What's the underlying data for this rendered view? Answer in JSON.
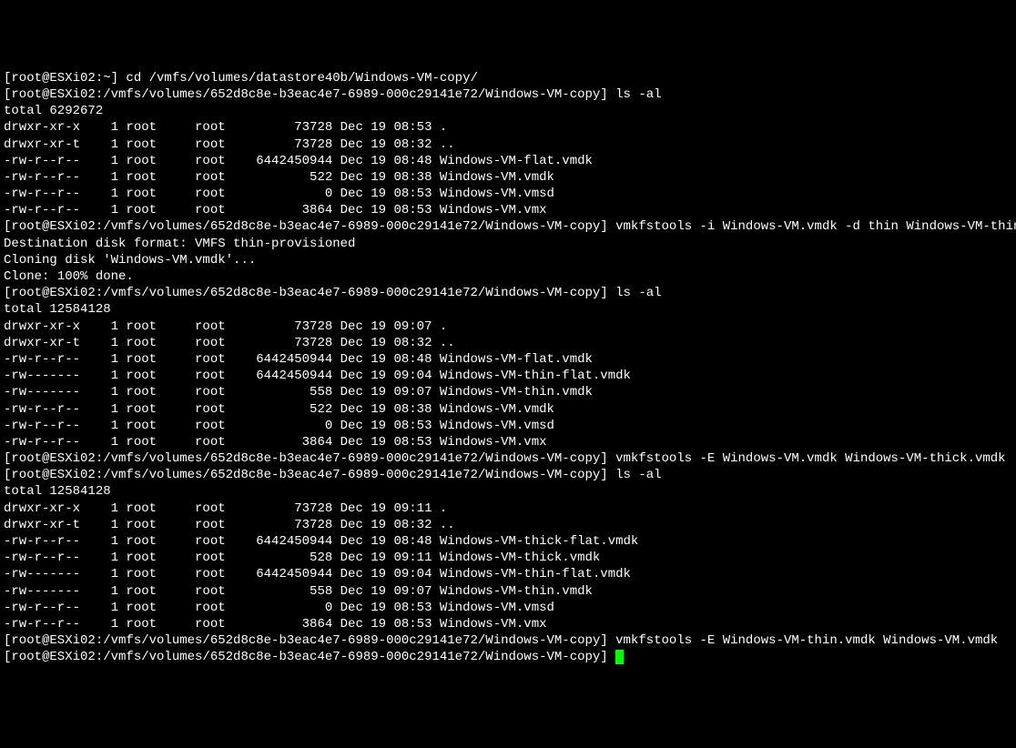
{
  "lines": [
    "[root@ESXi02:~] cd /vmfs/volumes/datastore40b/Windows-VM-copy/",
    "[root@ESXi02:/vmfs/volumes/652d8c8e-b3eac4e7-6989-000c29141e72/Windows-VM-copy] ls -al",
    "total 6292672",
    "drwxr-xr-x    1 root     root         73728 Dec 19 08:53 .",
    "drwxr-xr-t    1 root     root         73728 Dec 19 08:32 ..",
    "-rw-r--r--    1 root     root    6442450944 Dec 19 08:48 Windows-VM-flat.vmdk",
    "-rw-r--r--    1 root     root           522 Dec 19 08:38 Windows-VM.vmdk",
    "-rw-r--r--    1 root     root             0 Dec 19 08:53 Windows-VM.vmsd",
    "-rw-r--r--    1 root     root          3864 Dec 19 08:53 Windows-VM.vmx",
    "[root@ESXi02:/vmfs/volumes/652d8c8e-b3eac4e7-6989-000c29141e72/Windows-VM-copy] vmkfstools -i Windows-VM.vmdk -d thin Windows-VM-thin.vmdk",
    "Destination disk format: VMFS thin-provisioned",
    "Cloning disk 'Windows-VM.vmdk'...",
    "Clone: 100% done.",
    "[root@ESXi02:/vmfs/volumes/652d8c8e-b3eac4e7-6989-000c29141e72/Windows-VM-copy] ls -al",
    "total 12584128",
    "drwxr-xr-x    1 root     root         73728 Dec 19 09:07 .",
    "drwxr-xr-t    1 root     root         73728 Dec 19 08:32 ..",
    "-rw-r--r--    1 root     root    6442450944 Dec 19 08:48 Windows-VM-flat.vmdk",
    "-rw-------    1 root     root    6442450944 Dec 19 09:04 Windows-VM-thin-flat.vmdk",
    "-rw-------    1 root     root           558 Dec 19 09:07 Windows-VM-thin.vmdk",
    "-rw-r--r--    1 root     root           522 Dec 19 08:38 Windows-VM.vmdk",
    "-rw-r--r--    1 root     root             0 Dec 19 08:53 Windows-VM.vmsd",
    "-rw-r--r--    1 root     root          3864 Dec 19 08:53 Windows-VM.vmx",
    "[root@ESXi02:/vmfs/volumes/652d8c8e-b3eac4e7-6989-000c29141e72/Windows-VM-copy] vmkfstools -E Windows-VM.vmdk Windows-VM-thick.vmdk",
    "[root@ESXi02:/vmfs/volumes/652d8c8e-b3eac4e7-6989-000c29141e72/Windows-VM-copy] ls -al",
    "total 12584128",
    "drwxr-xr-x    1 root     root         73728 Dec 19 09:11 .",
    "drwxr-xr-t    1 root     root         73728 Dec 19 08:32 ..",
    "-rw-r--r--    1 root     root    6442450944 Dec 19 08:48 Windows-VM-thick-flat.vmdk",
    "-rw-r--r--    1 root     root           528 Dec 19 09:11 Windows-VM-thick.vmdk",
    "-rw-------    1 root     root    6442450944 Dec 19 09:04 Windows-VM-thin-flat.vmdk",
    "-rw-------    1 root     root           558 Dec 19 09:07 Windows-VM-thin.vmdk",
    "-rw-r--r--    1 root     root             0 Dec 19 08:53 Windows-VM.vmsd",
    "-rw-r--r--    1 root     root          3864 Dec 19 08:53 Windows-VM.vmx",
    "[root@ESXi02:/vmfs/volumes/652d8c8e-b3eac4e7-6989-000c29141e72/Windows-VM-copy] vmkfstools -E Windows-VM-thin.vmdk Windows-VM.vmdk",
    "[root@ESXi02:/vmfs/volumes/652d8c8e-b3eac4e7-6989-000c29141e72/Windows-VM-copy] "
  ]
}
